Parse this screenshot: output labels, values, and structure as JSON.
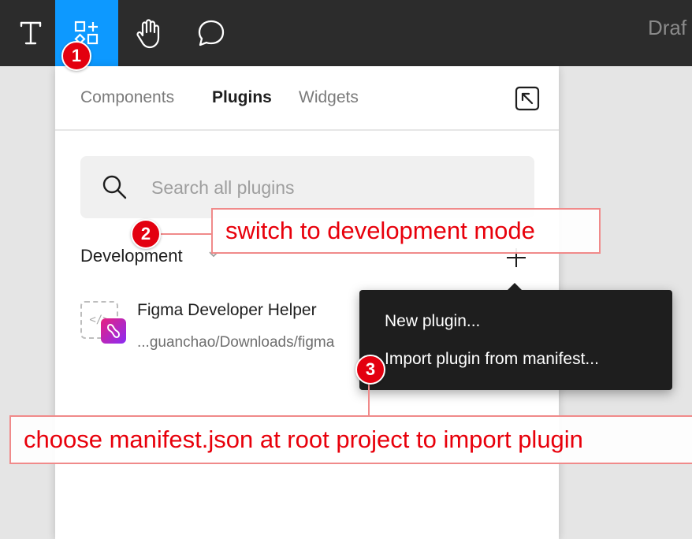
{
  "toolbar": {
    "tools": [
      {
        "name": "text-tool",
        "icon": "text-icon"
      },
      {
        "name": "resources-tool",
        "icon": "resources-icon",
        "active": true
      },
      {
        "name": "hand-tool",
        "icon": "hand-icon"
      },
      {
        "name": "comment-tool",
        "icon": "comment-icon"
      }
    ],
    "title": "Draf"
  },
  "panel": {
    "tabs": [
      {
        "label": "Components"
      },
      {
        "label": "Plugins",
        "active": true
      },
      {
        "label": "Widgets"
      }
    ],
    "search": {
      "placeholder": "Search all plugins",
      "value": ""
    },
    "section": {
      "label": "Development"
    },
    "plugin": {
      "name": "Figma Developer Helper",
      "path": "...guanchao/Downloads/figma",
      "icon_placeholder": "</>"
    }
  },
  "context_menu": {
    "items": [
      {
        "label": "New plugin..."
      },
      {
        "label": "Import plugin from manifest..."
      }
    ]
  },
  "annotations": {
    "badges": [
      "1",
      "2",
      "3"
    ],
    "notes": [
      "switch to development mode",
      "choose manifest.json at root project to import plugin"
    ]
  },
  "colors": {
    "toolbar_bg": "#2c2c2c",
    "accent_blue": "#0d99ff",
    "annotation_red": "#e3000f",
    "menu_bg": "#1e1e1e"
  }
}
